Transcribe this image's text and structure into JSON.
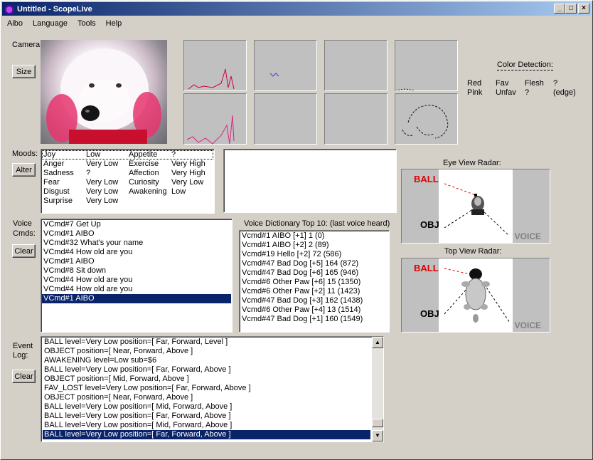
{
  "window": {
    "title": "Untitled - ScopeLive"
  },
  "menu": [
    "Aibo",
    "Language",
    "Tools",
    "Help"
  ],
  "camera": {
    "label": "Camera:",
    "size_button": "Size"
  },
  "color_detection": {
    "title": "Color Detection:",
    "rows": [
      [
        "Red",
        "Fav",
        "Flesh",
        "?"
      ],
      [
        "Pink",
        "Unfav",
        "?",
        "(edge)"
      ]
    ]
  },
  "moods": {
    "label": "Moods:",
    "alter_button": "Alter",
    "rows": [
      [
        "Joy",
        "Low",
        "Appetite",
        "?"
      ],
      [
        "Anger",
        "Very Low",
        "Exercise",
        "Very High"
      ],
      [
        "Sadness",
        "?",
        "Affection",
        "Very High"
      ],
      [
        "Fear",
        "Very Low",
        "Curiosity",
        "Very Low"
      ],
      [
        "Disgust",
        "Very Low",
        "Awakening",
        "Low"
      ],
      [
        "Surprise",
        "Very Low",
        "",
        ""
      ]
    ]
  },
  "voice": {
    "label_line1": "Voice",
    "label_line2": "Cmds:",
    "clear_button": "Clear",
    "items": [
      "VCmd#7 Get Up",
      "VCmd#1 AIBO",
      "VCmd#32 What's your name",
      "VCmd#4 How old are you",
      "VCmd#1 AIBO",
      "VCmd#8 Sit down",
      "VCmd#4 How old are you",
      "VCmd#4 How old are you",
      "VCmd#1 AIBO"
    ],
    "selected_index": 8
  },
  "dictionary": {
    "title": "Voice Dictionary Top 10: (last voice heard)",
    "items": [
      "Vcmd#1 AIBO [+1] 1 (0)",
      "Vcmd#1 AIBO [+2] 2 (89)",
      "Vcmd#19 Hello [+2] 72 (586)",
      "Vcmd#47 Bad Dog [+5] 164 (872)",
      "Vcmd#47 Bad Dog [+6] 165 (946)",
      "Vcmd#6 Other Paw [+6] 15 (1350)",
      "Vcmd#6 Other Paw [+2] 11 (1423)",
      "Vcmd#47 Bad Dog [+3] 162 (1438)",
      "Vcmd#6 Other Paw [+4] 13 (1514)",
      "Vcmd#47 Bad Dog [+1] 160 (1549)"
    ]
  },
  "event_log": {
    "label_line1": "Event",
    "label_line2": "Log:",
    "clear_button": "Clear",
    "items": [
      "BALL level=Very Low  position=[ Far, Forward, Level ]",
      "OBJECT    position=[ Near, Forward, Above ]",
      "AWAKENING level=Low    sub=$6",
      "BALL level=Very Low  position=[ Far, Forward, Above ]",
      "OBJECT    position=[ Mid, Forward, Above ]",
      "FAV_LOST level=Very Low  position=[ Far, Forward, Above ]",
      "OBJECT    position=[ Near, Forward, Above ]",
      "BALL level=Very Low  position=[ Mid, Forward, Above ]",
      "BALL level=Very Low  position=[ Far, Forward, Above ]",
      "BALL level=Very Low  position=[ Mid, Forward, Above ]",
      "BALL level=Very Low  position=[ Far, Forward, Above ]"
    ],
    "selected_index": 10
  },
  "eye_radar": {
    "title": "Eye View Radar:",
    "ball": "BALL",
    "obj": "OBJ",
    "voice": "VOICE"
  },
  "top_radar": {
    "title": "Top View Radar:",
    "ball": "BALL",
    "obj": "OBJ",
    "voice": "VOICE"
  }
}
